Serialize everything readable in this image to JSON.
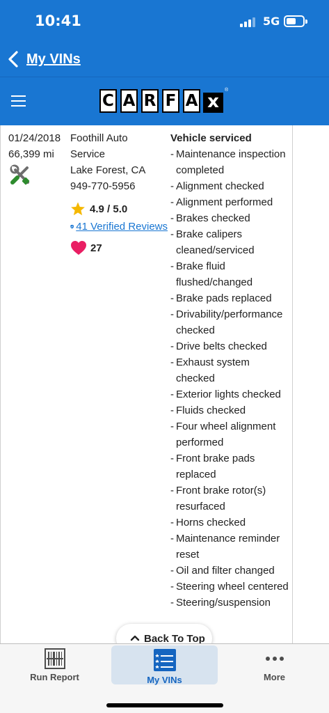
{
  "status_bar": {
    "time": "10:41",
    "network": "5G",
    "signal_bars_active": 3,
    "battery_level_percent": 45
  },
  "nav": {
    "back_label": "My VINs"
  },
  "header": {
    "logo_letters": [
      "C",
      "A",
      "R",
      "F",
      "A"
    ],
    "logo_x": "x",
    "logo_reg": "®"
  },
  "record": {
    "date": "01/24/2018",
    "mileage": "66,399 mi",
    "shop": {
      "name_line1": "Foothill Auto",
      "name_line2": "Service",
      "location": "Lake Forest, CA",
      "phone": "949-770-5956",
      "rating": "4.9 / 5.0",
      "reviews": "41 Verified Reviews",
      "favorites": "27"
    },
    "work": {
      "heading": "Vehicle serviced",
      "items": [
        "Maintenance inspection completed",
        "Alignment checked",
        "Alignment performed",
        "Brakes checked",
        "Brake calipers cleaned/serviced",
        "Brake fluid flushed/changed",
        "Brake pads replaced",
        "Drivability/performance checked",
        "Drive belts checked",
        "Exhaust system checked",
        "Exterior lights checked",
        "Fluids checked",
        "Four wheel alignment performed",
        "Front brake pads replaced",
        "Front brake rotor(s) resurfaced",
        "Horns checked",
        "Maintenance reminder reset",
        "Oil and filter changed",
        "Steering wheel centered",
        "Steering/suspension"
      ]
    }
  },
  "back_to_top": {
    "label": "Back To Top"
  },
  "tab_bar": {
    "tabs": [
      {
        "label": "Run Report",
        "icon": "barcode-icon"
      },
      {
        "label": "My VINs",
        "icon": "list-icon",
        "selected": true
      },
      {
        "label": "More",
        "icon": "more-dots-icon"
      }
    ]
  },
  "colors": {
    "brand_blue": "#1976d2",
    "star": "#f5b800",
    "heart": "#e91e63",
    "wrench_green": "#2e8b2e"
  }
}
